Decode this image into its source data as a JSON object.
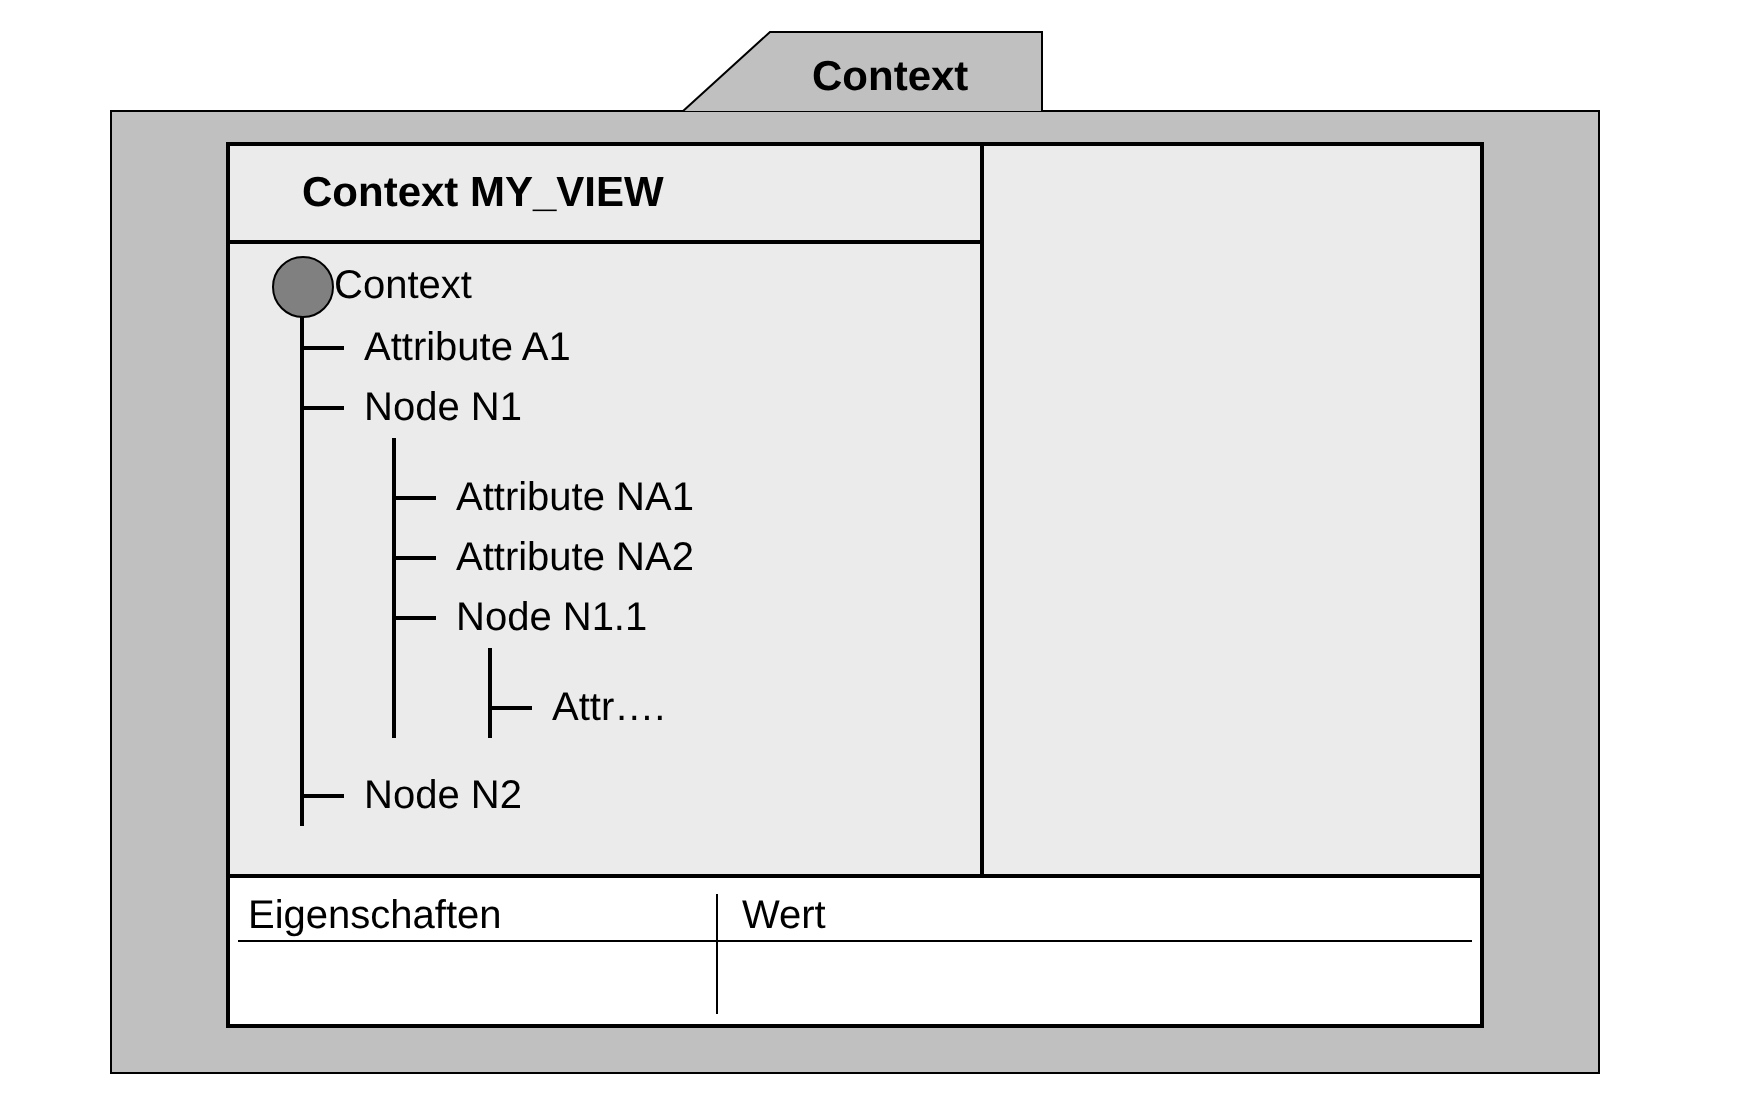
{
  "tab": {
    "label": "Context"
  },
  "tree_panel": {
    "title": "Context MY_VIEW",
    "root": {
      "label": "Context",
      "children": [
        {
          "label": "Attribute A1"
        },
        {
          "label": "Node N1",
          "children": [
            {
              "label": "Attribute NA1"
            },
            {
              "label": "Attribute NA2"
            },
            {
              "label": "Node N1.1",
              "children": [
                {
                  "label": "Attr…."
                }
              ]
            }
          ]
        },
        {
          "label": "Node N2"
        }
      ]
    }
  },
  "properties_table": {
    "columns": [
      "Eigenschaften",
      "Wert"
    ]
  }
}
